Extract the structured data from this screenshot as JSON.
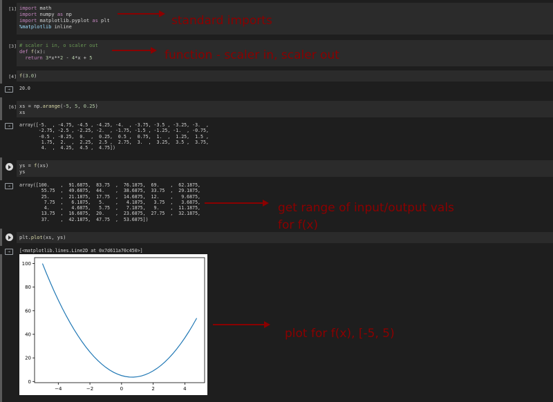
{
  "cells": [
    {
      "prompt": "[1]",
      "lines": [
        [
          {
            "t": "import",
            "c": "kw"
          },
          {
            "t": " math",
            "c": ""
          }
        ],
        [
          {
            "t": "import",
            "c": "kw"
          },
          {
            "t": " numpy ",
            "c": ""
          },
          {
            "t": "as",
            "c": "kw"
          },
          {
            "t": " np",
            "c": ""
          }
        ],
        [
          {
            "t": "import",
            "c": "kw"
          },
          {
            "t": " matplotlib.pyplot ",
            "c": ""
          },
          {
            "t": "as",
            "c": "kw"
          },
          {
            "t": " plt",
            "c": ""
          }
        ],
        [
          {
            "t": "%matplotlib",
            "c": "mg"
          },
          {
            "t": " inline",
            "c": ""
          }
        ]
      ]
    },
    {
      "prompt": "[3]",
      "lines": [
        [
          {
            "t": "# scaler i in, o scaler out",
            "c": "cm"
          }
        ],
        [
          {
            "t": "def",
            "c": "kw"
          },
          {
            "t": " ",
            "c": ""
          },
          {
            "t": "f",
            "c": "fn"
          },
          {
            "t": "(x):",
            "c": ""
          }
        ],
        [
          {
            "t": "  return ",
            "c": "kw"
          },
          {
            "t": "3",
            "c": "num"
          },
          {
            "t": "*x**",
            "c": ""
          },
          {
            "t": "2",
            "c": "num"
          },
          {
            "t": " - ",
            "c": ""
          },
          {
            "t": "4",
            "c": "num"
          },
          {
            "t": "*x + ",
            "c": ""
          },
          {
            "t": "5",
            "c": "num"
          }
        ]
      ]
    },
    {
      "prompt": "[4]",
      "lines": [
        [
          {
            "t": "f",
            "c": "fn"
          },
          {
            "t": "(",
            "c": ""
          },
          {
            "t": "3.0",
            "c": "num"
          },
          {
            "t": ")",
            "c": ""
          }
        ]
      ]
    },
    {
      "prompt": "[6]",
      "lines": [
        [
          {
            "t": "xs = np.",
            "c": ""
          },
          {
            "t": "arange",
            "c": "fn"
          },
          {
            "t": "(-",
            "c": ""
          },
          {
            "t": "5",
            "c": "num"
          },
          {
            "t": ", ",
            "c": ""
          },
          {
            "t": "5",
            "c": "num"
          },
          {
            "t": ", ",
            "c": ""
          },
          {
            "t": "0.25",
            "c": "num"
          },
          {
            "t": ")",
            "c": ""
          }
        ],
        [
          {
            "t": "xs",
            "c": ""
          }
        ]
      ]
    },
    {
      "prompt": "",
      "lines": [
        [
          {
            "t": "ys = ",
            "c": ""
          },
          {
            "t": "f",
            "c": "fn"
          },
          {
            "t": "(xs)",
            "c": ""
          }
        ],
        [
          {
            "t": "ys",
            "c": ""
          }
        ]
      ]
    },
    {
      "prompt": "",
      "lines": [
        [
          {
            "t": "plt.",
            "c": ""
          },
          {
            "t": "plot",
            "c": "fn"
          },
          {
            "t": "(xs, ys)",
            "c": ""
          }
        ]
      ]
    }
  ],
  "outputs": {
    "f3": "20.0",
    "xs": "array([-5.  , -4.75, -4.5 , -4.25, -4.  , -3.75, -3.5 , -3.25, -3.  ,\n       -2.75, -2.5 , -2.25, -2.  , -1.75, -1.5 , -1.25, -1.  , -0.75,\n       -0.5 , -0.25,  0.  ,  0.25,  0.5 ,  0.75,  1.  ,  1.25,  1.5 ,\n        1.75,  2.  ,  2.25,  2.5 ,  2.75,  3.  ,  3.25,  3.5 ,  3.75,\n        4.  ,  4.25,  4.5 ,  4.75])",
    "ys": "array([100.    ,  91.6875,  83.75  ,  76.1875,  69.    ,  62.1875,\n        55.75  ,  49.6875,  44.    ,  38.6875,  33.75  ,  29.1875,\n        25.    ,  21.1875,  17.75  ,  14.6875,  12.    ,   9.6875,\n         7.75  ,   6.1875,   5.    ,   4.1875,   3.75  ,   3.6875,\n         4.    ,   4.6875,   5.75  ,   7.1875,   9.    ,  11.1875,\n        13.75  ,  16.6875,  20.    ,  23.6875,  27.75  ,  32.1875,\n        37.    ,  42.1875,  47.75  ,  53.6875])",
    "plot_repr": "[<matplotlib.lines.Line2D at 0x7d611a70c450>]"
  },
  "output_icon": "output-arrow-icon",
  "run_icon": "run-cell-icon",
  "annotations": {
    "imports": "standard imports",
    "function": "function - scaler in, scaler out",
    "range": "get range of input/output vals",
    "range2": "for f(x)",
    "plot": "plot for f(x), [-5, 5)"
  },
  "colors": {
    "annotation": "#8b0000",
    "line": "#1f77b4"
  },
  "chart_data": {
    "type": "line",
    "x": [
      -5.0,
      -4.75,
      -4.5,
      -4.25,
      -4.0,
      -3.75,
      -3.5,
      -3.25,
      -3.0,
      -2.75,
      -2.5,
      -2.25,
      -2.0,
      -1.75,
      -1.5,
      -1.25,
      -1.0,
      -0.75,
      -0.5,
      -0.25,
      0.0,
      0.25,
      0.5,
      0.75,
      1.0,
      1.25,
      1.5,
      1.75,
      2.0,
      2.25,
      2.5,
      2.75,
      3.0,
      3.25,
      3.5,
      3.75,
      4.0,
      4.25,
      4.5,
      4.75
    ],
    "series": [
      {
        "values": [
          100.0,
          91.6875,
          83.75,
          76.1875,
          69.0,
          62.1875,
          55.75,
          49.6875,
          44.0,
          38.6875,
          33.75,
          29.1875,
          25.0,
          21.1875,
          17.75,
          14.6875,
          12.0,
          9.6875,
          7.75,
          6.1875,
          5.0,
          4.1875,
          3.75,
          3.6875,
          4.0,
          4.6875,
          5.75,
          7.1875,
          9.0,
          11.1875,
          13.75,
          16.6875,
          20.0,
          23.6875,
          27.75,
          32.1875,
          37.0,
          42.1875,
          47.75,
          53.6875
        ]
      }
    ],
    "xticks": [
      -4,
      -2,
      0,
      2,
      4
    ],
    "yticks": [
      0,
      20,
      40,
      60,
      80,
      100
    ],
    "xlim": [
      -5.5,
      5.25
    ],
    "ylim": [
      -1,
      105
    ],
    "grid": false
  }
}
